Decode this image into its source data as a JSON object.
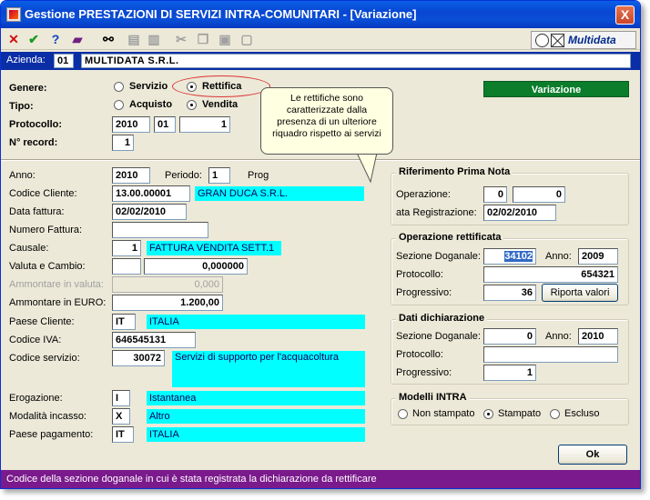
{
  "window": {
    "title": "Gestione PRESTAZIONI DI SERVIZI INTRA-COMUNITARI - [Variazione]",
    "close_label": "X"
  },
  "toolbar": {
    "icons": [
      "close-icon",
      "confirm-check-icon",
      "help-icon",
      "book-icon",
      "binoculars-icon",
      "print-icon",
      "print-preview-icon",
      "cut-icon",
      "copy-icon",
      "paste-icon",
      "new-document-icon"
    ],
    "logo_text": "Multidata"
  },
  "azienda": {
    "label": "Azienda:",
    "code": "01",
    "name": "MULTIDATA S.R.L."
  },
  "header": {
    "genere_label": "Genere:",
    "genere_options": [
      "Servizio",
      "Rettifica"
    ],
    "genere_selected": "Rettifica",
    "tipo_label": "Tipo:",
    "tipo_options": [
      "Acquisto",
      "Vendita"
    ],
    "tipo_selected": "Vendita",
    "protocollo_label": "Protocollo:",
    "protocollo_year": "2010",
    "protocollo_sez": "01",
    "protocollo_num": "1",
    "record_label": "N° record:",
    "record_value": "1",
    "mode_badge": "Variazione"
  },
  "callout": {
    "text": "Le rettifiche sono caratterizzate dalla presenza di un ulteriore riquadro rispetto ai servizi"
  },
  "left": {
    "anno_label": "Anno:",
    "anno": "2010",
    "periodo_label": "Periodo:",
    "periodo": "1",
    "prog_label": "Prog",
    "cliente_label": "Codice Cliente:",
    "cliente_code": "13.00.00001",
    "cliente_name": "GRAN DUCA S.R.L.",
    "data_fattura_label": "Data fattura:",
    "data_fattura": "02/02/2010",
    "numero_fattura_label": "Numero Fattura:",
    "numero_fattura": "",
    "causale_label": "Causale:",
    "causale_code": "1",
    "causale_desc": "FATTURA VENDITA SETT.1",
    "valuta_label": "Valuta e Cambio:",
    "valuta_code": "",
    "cambio": "0,000000",
    "ammontare_valuta_label": "Ammontare in valuta:",
    "ammontare_valuta": "0,000",
    "ammontare_euro_label": "Ammontare in EURO:",
    "ammontare_euro": "1.200,00",
    "paese_cliente_label": "Paese Cliente:",
    "paese_cliente_code": "IT",
    "paese_cliente_name": "ITALIA",
    "codice_iva_label": "Codice IVA:",
    "codice_iva": "646545131",
    "codice_servizio_label": "Codice servizio:",
    "codice_servizio": "30072",
    "codice_servizio_desc": "Servizi di supporto per l'acquacoltura",
    "erogazione_label": "Erogazione:",
    "erogazione_code": "I",
    "erogazione_desc": "Istantanea",
    "modalita_label": "Modalità incasso:",
    "modalita_code": "X",
    "modalita_desc": "Altro",
    "paese_pagamento_label": "Paese pagamento:",
    "paese_pagamento_code": "IT",
    "paese_pagamento_name": "ITALIA"
  },
  "prima_nota": {
    "title": "Riferimento Prima Nota",
    "operazione_label": "Operazione:",
    "operazione_1": "0",
    "operazione_2": "0",
    "data_reg_label": "ata Registrazione:",
    "data_reg": "02/02/2010"
  },
  "rettificata": {
    "title": "Operazione rettificata",
    "sezione_label": "Sezione Doganale:",
    "sezione": "34102",
    "anno_label": "Anno:",
    "anno": "2009",
    "protocollo_label": "Protocollo:",
    "protocollo": "654321",
    "progressivo_label": "Progressivo:",
    "progressivo": "36",
    "riporta_label": "Riporta valori"
  },
  "dichiarazione": {
    "title": "Dati dichiarazione",
    "sezione_label": "Sezione Doganale:",
    "sezione": "0",
    "anno_label": "Anno:",
    "anno": "2010",
    "protocollo_label": "Protocollo:",
    "protocollo": "",
    "progressivo_label": "Progressivo:",
    "progressivo": "1"
  },
  "modelli": {
    "title": "Modelli INTRA",
    "options": [
      "Non stampato",
      "Stampato",
      "Escluso"
    ],
    "selected": "Stampato"
  },
  "ok_label": "Ok",
  "status": "Codice della sezione doganale in cui è stata registrata la dichiarazione da rettificare"
}
